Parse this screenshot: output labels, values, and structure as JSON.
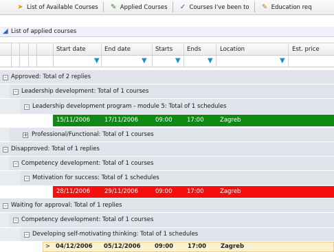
{
  "toolbar": {
    "items": [
      {
        "label": "List of Available Courses",
        "icon": "course-list-icon"
      },
      {
        "label": "Applied Courses",
        "icon": "applied-icon"
      },
      {
        "label": "Courses I've been to",
        "icon": "checkmark-icon"
      },
      {
        "label": "Education req",
        "icon": "document-icon"
      }
    ]
  },
  "panel": {
    "title": "List of applied courses"
  },
  "columns": [
    "Start date",
    "End date",
    "Starts",
    "Ends",
    "Location",
    "Est. price"
  ],
  "colors": {
    "approved": "#0e8a14",
    "disapproved": "#f50f0f",
    "selected": "#fbf1cf",
    "group": "#e1e4ea"
  },
  "groups": {
    "approved": {
      "label": "Approved: Total of 2 replies",
      "leadership": "Leadership development: Total of 1 courses",
      "leadership_program": "Leadership development program - module 5: Total of 1 schedules",
      "leadership_row": [
        "15/11/2006",
        "17/11/2006",
        "09:00",
        "17:00",
        "Zagreb"
      ],
      "professional": "Professional/Functional: Total of 1 courses"
    },
    "disapproved": {
      "label": "Disapproved: Total of 1 replies",
      "competency": "Competency development: Total of 1 courses",
      "motivation": "Motivation for success: Total of 1 schedules",
      "motivation_row": [
        "28/11/2006",
        "29/11/2006",
        "09:00",
        "17:00",
        "Zagreb"
      ]
    },
    "waiting": {
      "label": "Waiting for approval: Total of 1 replies",
      "competency": "Competency development: Total of 1 courses",
      "selfmotivating": "Developing self-motivating thinking: Total of 1 schedules",
      "selfmotivating_row": [
        "04/12/2006",
        "05/12/2006",
        "09:00",
        "17:00",
        "Zagreb"
      ]
    }
  }
}
